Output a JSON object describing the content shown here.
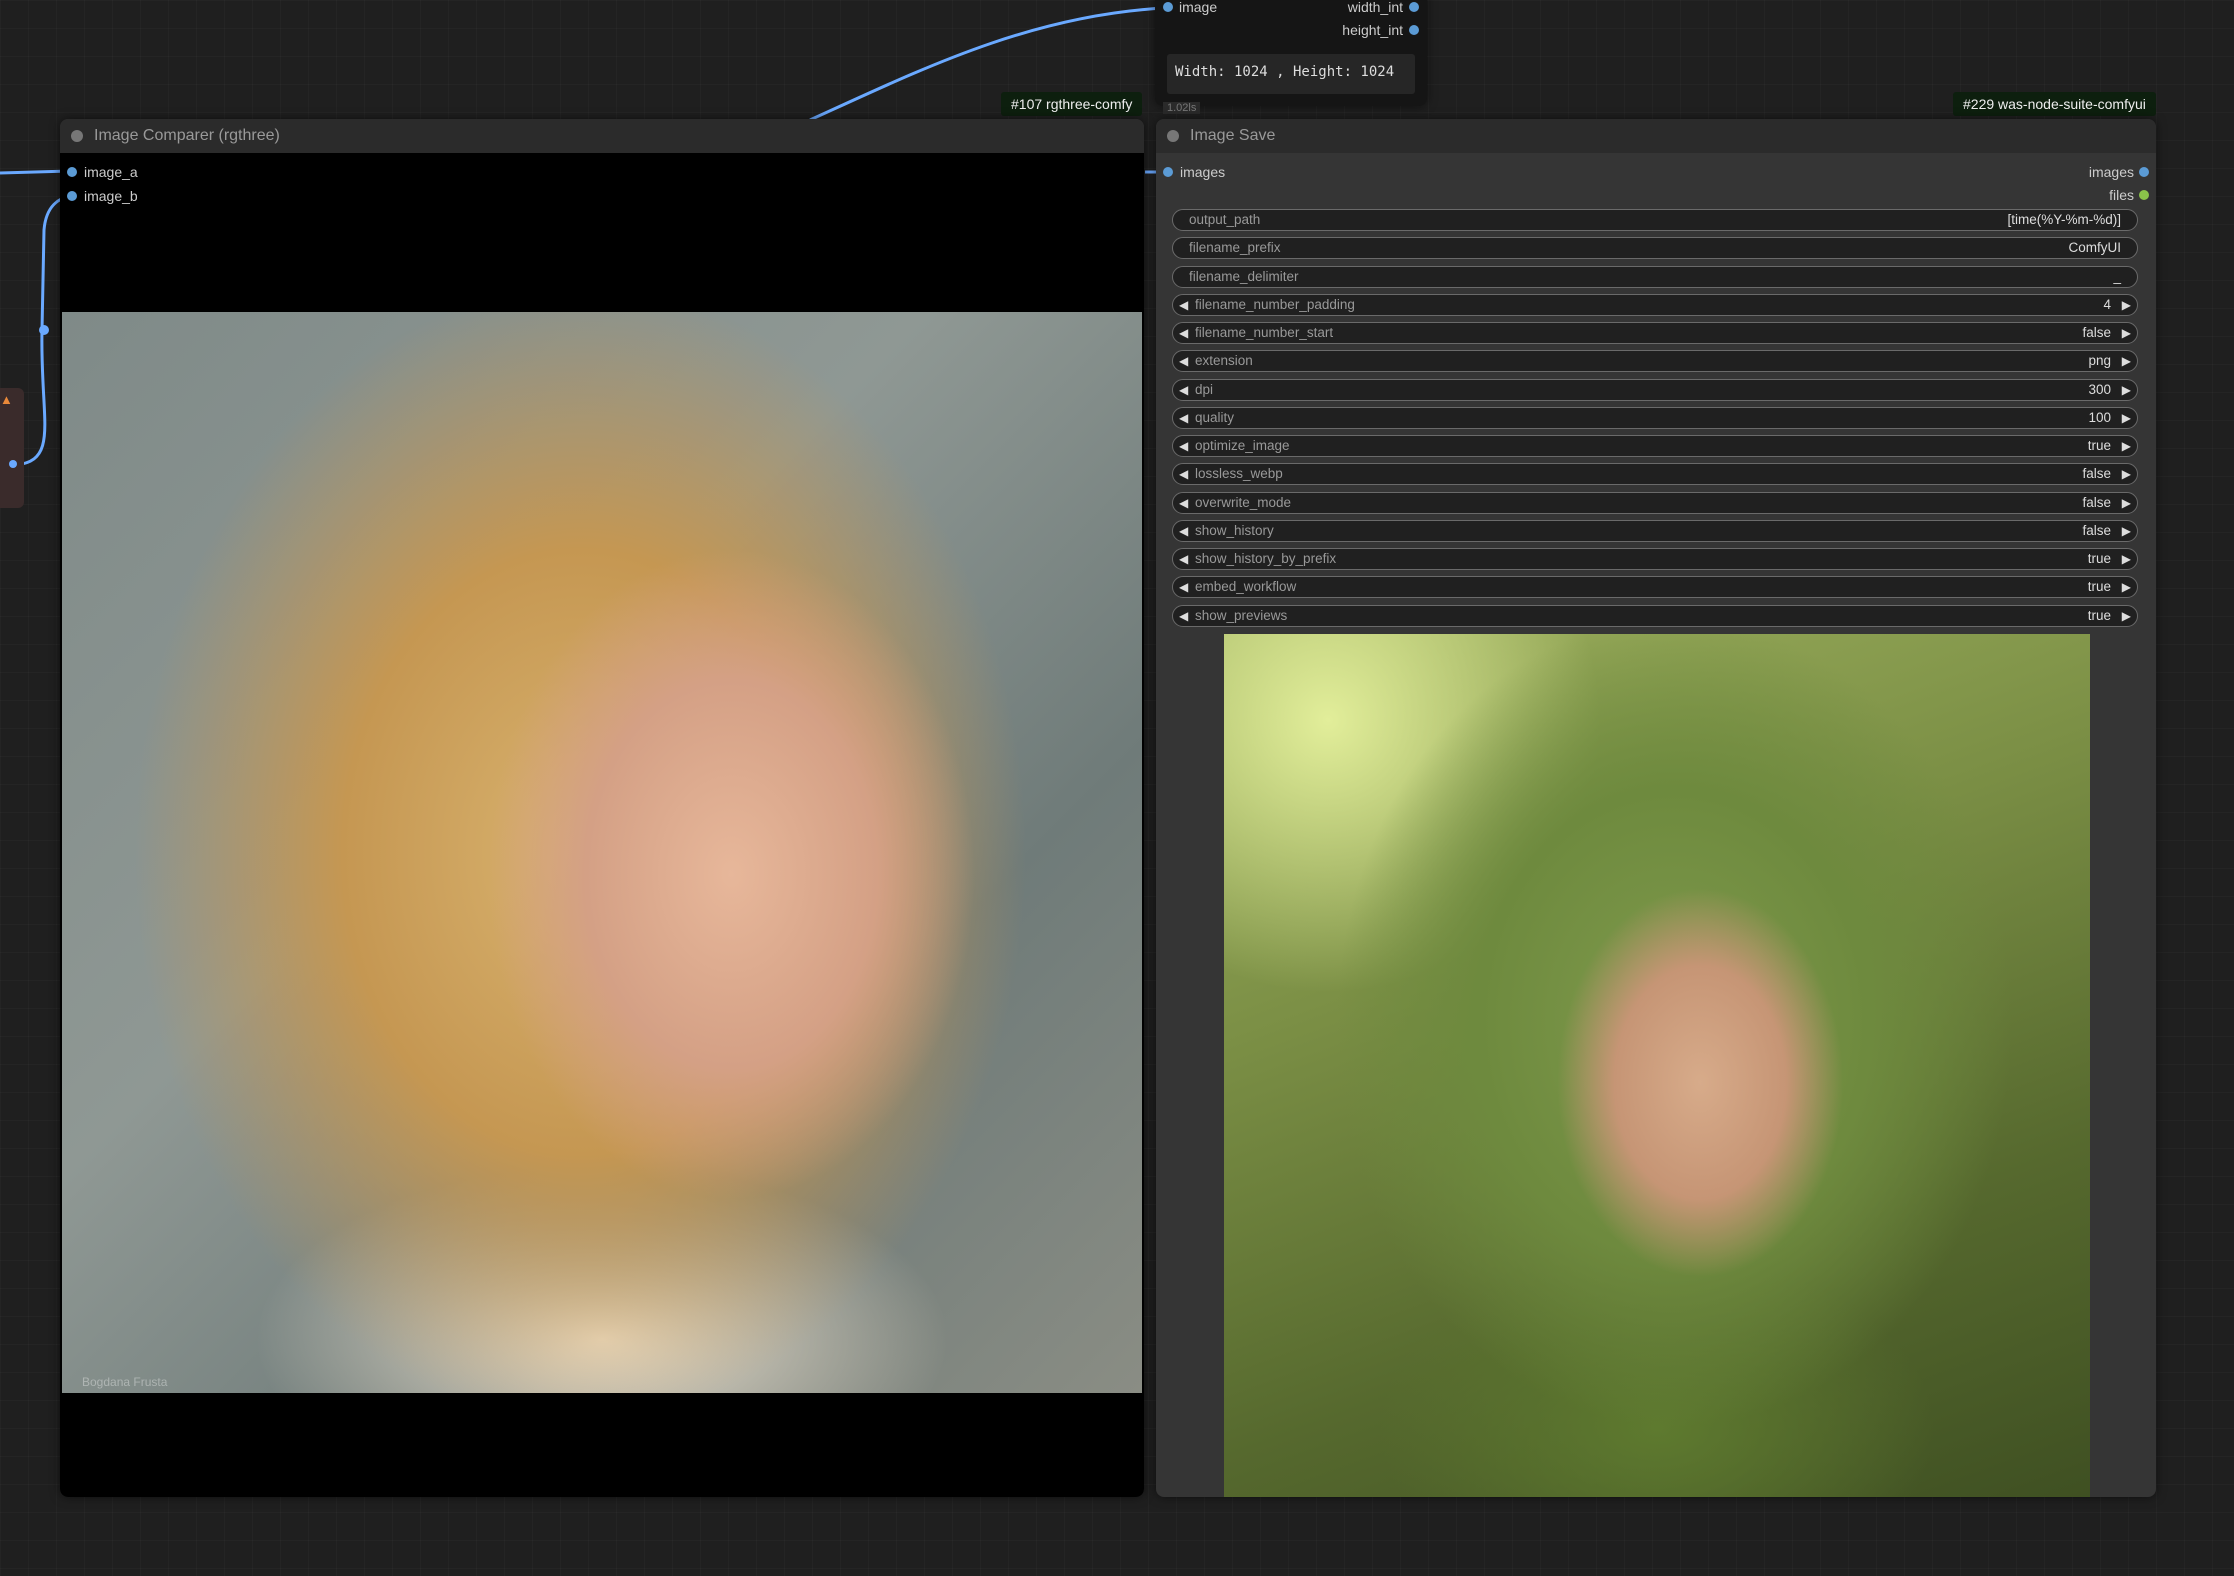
{
  "top_node": {
    "inputs": [
      "image"
    ],
    "outputs": [
      "width_int",
      "height_int"
    ],
    "display_text": "Width: 1024 , Height: 1024",
    "timing": "1.02ls"
  },
  "comparer_node": {
    "badge": "#107 rgthree-comfy",
    "title": "Image Comparer (rgthree)",
    "inputs": [
      "image_a",
      "image_b"
    ],
    "watermark": "Bogdana Frusta"
  },
  "save_node": {
    "badge": "#229 was-node-suite-comfyui",
    "title": "Image Save",
    "inputs": [
      "images"
    ],
    "outputs": [
      "images",
      "files"
    ],
    "widgets": [
      {
        "label": "output_path",
        "value": "[time(%Y-%m-%d)]",
        "arrows": false
      },
      {
        "label": "filename_prefix",
        "value": "ComfyUI",
        "arrows": false
      },
      {
        "label": "filename_delimiter",
        "value": "_",
        "arrows": false
      },
      {
        "label": "filename_number_padding",
        "value": "4",
        "arrows": true
      },
      {
        "label": "filename_number_start",
        "value": "false",
        "arrows": true
      },
      {
        "label": "extension",
        "value": "png",
        "arrows": true
      },
      {
        "label": "dpi",
        "value": "300",
        "arrows": true
      },
      {
        "label": "quality",
        "value": "100",
        "arrows": true
      },
      {
        "label": "optimize_image",
        "value": "true",
        "arrows": true
      },
      {
        "label": "lossless_webp",
        "value": "false",
        "arrows": true
      },
      {
        "label": "overwrite_mode",
        "value": "false",
        "arrows": true
      },
      {
        "label": "show_history",
        "value": "false",
        "arrows": true
      },
      {
        "label": "show_history_by_prefix",
        "value": "true",
        "arrows": true
      },
      {
        "label": "embed_workflow",
        "value": "true",
        "arrows": true
      },
      {
        "label": "show_previews",
        "value": "true",
        "arrows": true
      }
    ]
  },
  "left_node": {
    "icon": "fox-icon"
  },
  "colors": {
    "wire_blue": "#6aa9ff",
    "slot_blue": "#5b9bd5",
    "slot_green": "#8bc34a",
    "badge_bg": "#0d1f0e"
  }
}
